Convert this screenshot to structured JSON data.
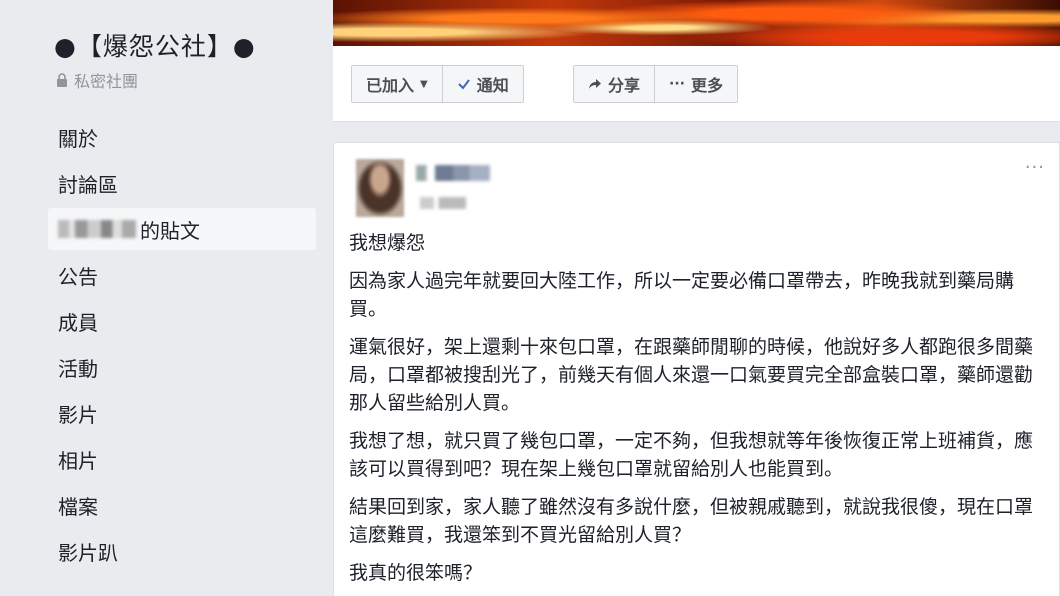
{
  "group": {
    "name": "●【爆怨公社】●",
    "privacy": "私密社團"
  },
  "sidebar": {
    "items": [
      {
        "label": "關於"
      },
      {
        "label": "討論區"
      },
      {
        "label": "的貼文"
      },
      {
        "label": "公告"
      },
      {
        "label": "成員"
      },
      {
        "label": "活動"
      },
      {
        "label": "影片"
      },
      {
        "label": "相片"
      },
      {
        "label": "檔案"
      },
      {
        "label": "影片趴"
      }
    ]
  },
  "actions": {
    "joined": "已加入",
    "notify": "通知",
    "share": "分享",
    "more": "更多"
  },
  "post": {
    "more_icon": "···",
    "paragraphs": [
      "我想爆怨",
      "因為家人過完年就要回大陸工作，所以一定要必備口罩帶去，昨晚我就到藥局購買。",
      "運氣很好，架上還剩十來包口罩，在跟藥師閒聊的時候，他說好多人都跑很多間藥局，口罩都被搜刮光了，前幾天有個人來還一口氣要買完全部盒裝口罩，藥師還勸那人留些給別人買。",
      "我想了想，就只買了幾包口罩，一定不夠，但我想就等年後恢復正常上班補貨，應該可以買得到吧？現在架上幾包口罩就留給別人也能買到。",
      "結果回到家，家人聽了雖然沒有多說什麼，但被親戚聽到，就說我很傻，現在口罩這麼難買，我還笨到不買光留給別人買？",
      "我真的很笨嗎？"
    ]
  },
  "icons": {
    "lock": "lock-icon",
    "caret": "caret-down-icon",
    "check": "check-icon",
    "share": "share-arrow-icon",
    "ellipsis": "ellipsis-icon"
  },
  "colors": {
    "page_bg": "#e9ebee",
    "card_bg": "#ffffff",
    "link_blue": "#4267b2"
  }
}
